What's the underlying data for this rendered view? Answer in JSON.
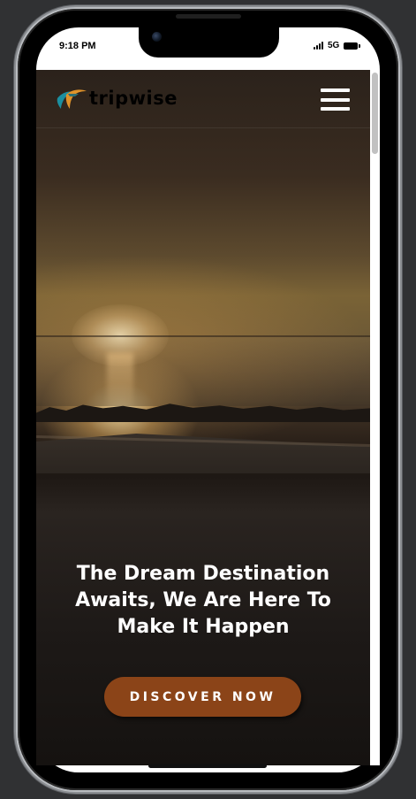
{
  "status_bar": {
    "time": "9:18 PM",
    "network": "5G"
  },
  "site": {
    "brand": "tripwise",
    "logo_colors": {
      "left_swoosh": "#1b8fa0",
      "right_swoosh": "#e0932a",
      "text": "#000000"
    }
  },
  "header": {
    "menu_icon": "hamburger-menu-icon"
  },
  "hero": {
    "title": "The Dream Destination Awaits, We Are Here To Make It Happen",
    "cta_label": "DISCOVER NOW",
    "cta_color": "#8b4418"
  }
}
